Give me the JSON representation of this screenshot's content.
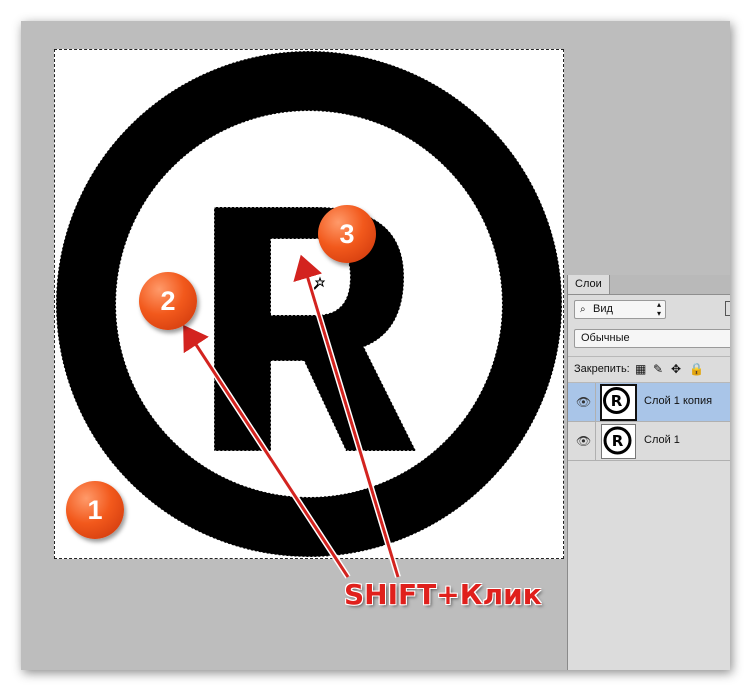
{
  "panel": {
    "tab_label": "Слои",
    "filter_label": "Вид",
    "blend_mode": "Обычные",
    "lock_label": "Закрепить:",
    "layers": [
      {
        "name": "Слой 1 копия",
        "visible": true,
        "active": true
      },
      {
        "name": "Слой 1",
        "visible": true,
        "active": false
      }
    ]
  },
  "annotations": {
    "badges": [
      "1",
      "2",
      "3"
    ],
    "instruction": "SHIFT+Клик"
  },
  "colors": {
    "badge": "#f2591c",
    "arrow": "#d3231f",
    "layer_selected": "#a9c5e8"
  },
  "icons": [
    "magnifier-icon",
    "eye-icon",
    "lock-pixels-icon",
    "lock-brush-icon",
    "lock-move-icon",
    "lock-all-icon",
    "magic-wand-cursor-icon"
  ]
}
